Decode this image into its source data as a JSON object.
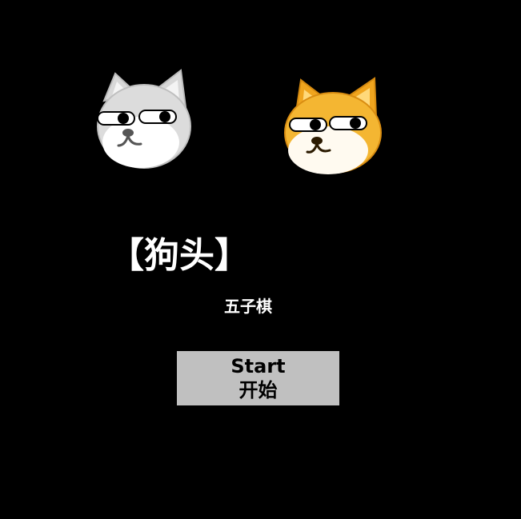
{
  "colors": {
    "background": "#000000",
    "text": "#ffffff",
    "button_bg": "#c0c0c0",
    "button_text": "#000000",
    "doge_gray": "#e0e0e0",
    "doge_orange": "#f2b233"
  },
  "icons": {
    "left": "gray-doge-face-icon",
    "right": "orange-doge-face-icon"
  },
  "game": {
    "title": "【狗头】",
    "subtitle": "五子棋"
  },
  "start_button": {
    "line1": "Start",
    "line2": "开始"
  }
}
